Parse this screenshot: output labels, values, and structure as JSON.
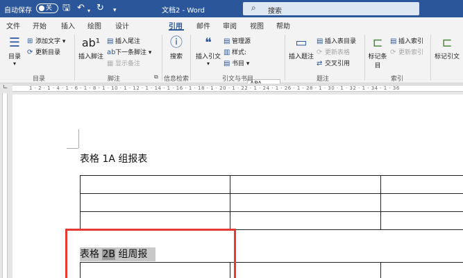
{
  "titlebar": {
    "autosave_label": "自动保存",
    "autosave_state": "关",
    "doc_title": "文档2 - Word",
    "search_placeholder": "搜索"
  },
  "tabs": [
    "文件",
    "开始",
    "插入",
    "绘图",
    "设计",
    "引用",
    "邮件",
    "审阅",
    "视图",
    "帮助"
  ],
  "active_tab": "引用",
  "ribbon": {
    "toc": {
      "big": "目录",
      "add_text": "添加文字",
      "update_toc": "更新目录",
      "label": "目录"
    },
    "footnotes": {
      "big": "插入脚注",
      "insert_endnote": "插入尾注",
      "next_footnote": "下一条脚注",
      "show_notes": "显示备注",
      "label": "脚注"
    },
    "research": {
      "big": "搜索",
      "label": "信息检索"
    },
    "citations": {
      "big": "插入引文",
      "manage_sources": "管理源",
      "style_label": "样式:",
      "style_value": "APA",
      "bibliography": "书目",
      "label": "引文与书目"
    },
    "captions": {
      "big": "插入题注",
      "insert_table_of_figures": "插入表目录",
      "update_table": "更新表格",
      "cross_reference": "交叉引用",
      "label": "题注"
    },
    "index": {
      "big": "标记条目",
      "insert_index": "插入索引",
      "update_index": "更新索引",
      "label": "索引"
    },
    "table_of_authorities": {
      "big": "标记引文"
    }
  },
  "ruler_text": "1 · 2 · 1 · 4 · 1 · 6 · 1 · 8 · 1 · 10 · 1 · 12 · 1 · 14 · 1 · 16 · 1 · 18 · 1 · 20 · 1 · 22 · 1 · 24 · 1 · 26 · 1 · 28 · 1 · 30 · 1 · 32 · 1 · 34 · 1 · 36",
  "document": {
    "heading1": "表格 1A 组报表",
    "heading2_prefix": "表格 ",
    "heading2_selected": "2B",
    "heading2_suffix": " 组周报"
  },
  "colors": {
    "accent": "#2b579a",
    "highlight_box": "#e53935"
  }
}
